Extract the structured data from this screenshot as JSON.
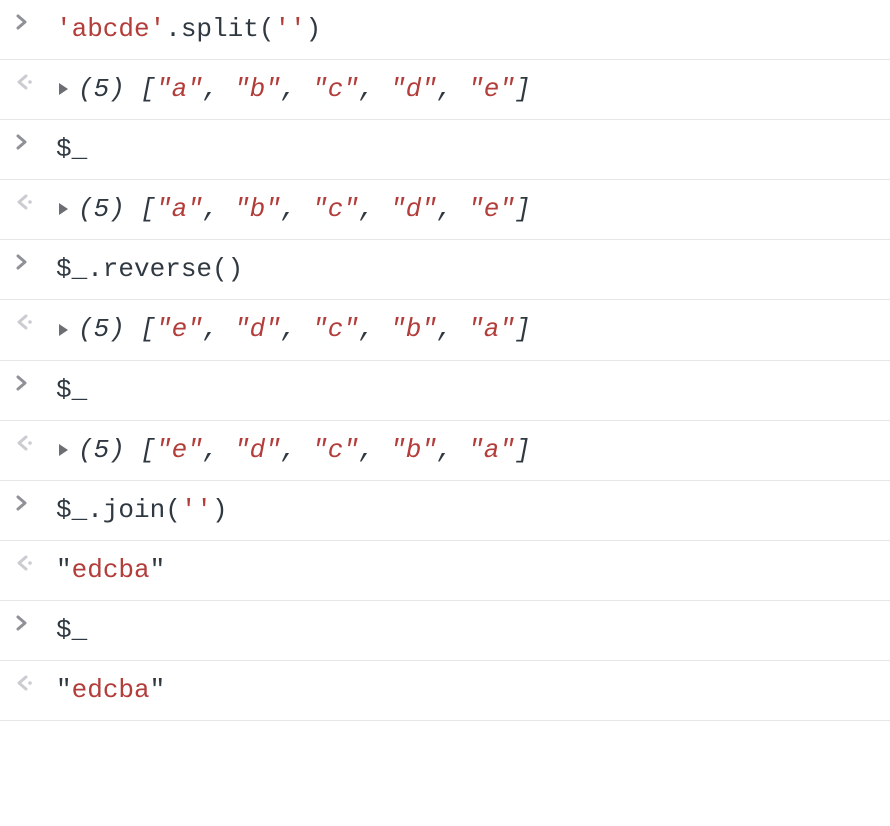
{
  "entries": [
    {
      "type": "input",
      "tokens": [
        {
          "t": "'abcde'",
          "c": "str"
        },
        {
          "t": ".split(",
          "c": "code"
        },
        {
          "t": "''",
          "c": "str"
        },
        {
          "t": ")",
          "c": "code"
        }
      ]
    },
    {
      "type": "output",
      "expandable": true,
      "tokens": [
        {
          "t": "(5) ",
          "c": "italic code"
        },
        {
          "t": "[",
          "c": "italic code"
        },
        {
          "t": "\"a\"",
          "c": "italic str"
        },
        {
          "t": ", ",
          "c": "italic code"
        },
        {
          "t": "\"b\"",
          "c": "italic str"
        },
        {
          "t": ", ",
          "c": "italic code"
        },
        {
          "t": "\"c\"",
          "c": "italic str"
        },
        {
          "t": ", ",
          "c": "italic code"
        },
        {
          "t": "\"d\"",
          "c": "italic str"
        },
        {
          "t": ", ",
          "c": "italic code"
        },
        {
          "t": "\"e\"",
          "c": "italic str"
        },
        {
          "t": "]",
          "c": "italic code"
        }
      ]
    },
    {
      "type": "input",
      "tokens": [
        {
          "t": "$_",
          "c": "code"
        }
      ]
    },
    {
      "type": "output",
      "expandable": true,
      "tokens": [
        {
          "t": "(5) ",
          "c": "italic code"
        },
        {
          "t": "[",
          "c": "italic code"
        },
        {
          "t": "\"a\"",
          "c": "italic str"
        },
        {
          "t": ", ",
          "c": "italic code"
        },
        {
          "t": "\"b\"",
          "c": "italic str"
        },
        {
          "t": ", ",
          "c": "italic code"
        },
        {
          "t": "\"c\"",
          "c": "italic str"
        },
        {
          "t": ", ",
          "c": "italic code"
        },
        {
          "t": "\"d\"",
          "c": "italic str"
        },
        {
          "t": ", ",
          "c": "italic code"
        },
        {
          "t": "\"e\"",
          "c": "italic str"
        },
        {
          "t": "]",
          "c": "italic code"
        }
      ]
    },
    {
      "type": "input",
      "tokens": [
        {
          "t": "$_.reverse()",
          "c": "code"
        }
      ]
    },
    {
      "type": "output",
      "expandable": true,
      "tokens": [
        {
          "t": "(5) ",
          "c": "italic code"
        },
        {
          "t": "[",
          "c": "italic code"
        },
        {
          "t": "\"e\"",
          "c": "italic str"
        },
        {
          "t": ", ",
          "c": "italic code"
        },
        {
          "t": "\"d\"",
          "c": "italic str"
        },
        {
          "t": ", ",
          "c": "italic code"
        },
        {
          "t": "\"c\"",
          "c": "italic str"
        },
        {
          "t": ", ",
          "c": "italic code"
        },
        {
          "t": "\"b\"",
          "c": "italic str"
        },
        {
          "t": ", ",
          "c": "italic code"
        },
        {
          "t": "\"a\"",
          "c": "italic str"
        },
        {
          "t": "]",
          "c": "italic code"
        }
      ]
    },
    {
      "type": "input",
      "tokens": [
        {
          "t": "$_",
          "c": "code"
        }
      ]
    },
    {
      "type": "output",
      "expandable": true,
      "tokens": [
        {
          "t": "(5) ",
          "c": "italic code"
        },
        {
          "t": "[",
          "c": "italic code"
        },
        {
          "t": "\"e\"",
          "c": "italic str"
        },
        {
          "t": ", ",
          "c": "italic code"
        },
        {
          "t": "\"d\"",
          "c": "italic str"
        },
        {
          "t": ", ",
          "c": "italic code"
        },
        {
          "t": "\"c\"",
          "c": "italic str"
        },
        {
          "t": ", ",
          "c": "italic code"
        },
        {
          "t": "\"b\"",
          "c": "italic str"
        },
        {
          "t": ", ",
          "c": "italic code"
        },
        {
          "t": "\"a\"",
          "c": "italic str"
        },
        {
          "t": "]",
          "c": "italic code"
        }
      ]
    },
    {
      "type": "input",
      "tokens": [
        {
          "t": "$_.join(",
          "c": "code"
        },
        {
          "t": "''",
          "c": "str"
        },
        {
          "t": ")",
          "c": "code"
        }
      ]
    },
    {
      "type": "output",
      "expandable": false,
      "tokens": [
        {
          "t": "\"",
          "c": "code"
        },
        {
          "t": "edcba",
          "c": "str"
        },
        {
          "t": "\"",
          "c": "code"
        }
      ]
    },
    {
      "type": "input",
      "tokens": [
        {
          "t": "$_",
          "c": "code"
        }
      ]
    },
    {
      "type": "output",
      "expandable": false,
      "tokens": [
        {
          "t": "\"",
          "c": "code"
        },
        {
          "t": "edcba",
          "c": "str"
        },
        {
          "t": "\"",
          "c": "code"
        }
      ]
    }
  ]
}
